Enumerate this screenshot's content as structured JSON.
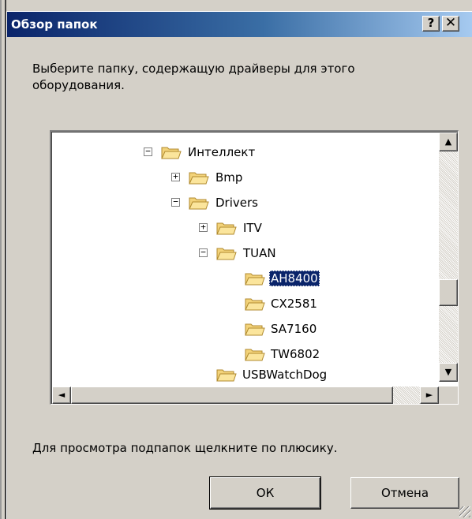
{
  "dialog": {
    "title": "Обзор папок",
    "help_glyph": "?",
    "close_glyph": "✕",
    "message": "Выберите папку, содержащую драйверы для этого оборудования.",
    "hint": "Для просмотра подпапок щелкните по плюсику.",
    "ok_label": "ОК",
    "cancel_label": "Отмена"
  },
  "tree": {
    "nodes": [
      {
        "label": "Интеллект",
        "expander": "−",
        "selected": false
      },
      {
        "label": "Bmp",
        "expander": "+",
        "selected": false
      },
      {
        "label": "Drivers",
        "expander": "−",
        "selected": false
      },
      {
        "label": "ITV",
        "expander": "+",
        "selected": false
      },
      {
        "label": "TUAN",
        "expander": "−",
        "selected": false
      },
      {
        "label": "AH8400",
        "expander": "",
        "selected": true
      },
      {
        "label": "CX2581",
        "expander": "",
        "selected": false
      },
      {
        "label": "SA7160",
        "expander": "",
        "selected": false
      },
      {
        "label": "TW6802",
        "expander": "",
        "selected": false
      },
      {
        "label": "USBWatchDog",
        "expander": "",
        "selected": false
      }
    ],
    "scroll_up": "▲",
    "scroll_down": "▼",
    "scroll_left": "◄",
    "scroll_right": "►"
  },
  "colors": {
    "titlebar_start": "#0a246a",
    "titlebar_end": "#a6caf0",
    "selection": "#0a246a",
    "folder_fill": "#f3d37a",
    "folder_stroke": "#b08a2e"
  }
}
